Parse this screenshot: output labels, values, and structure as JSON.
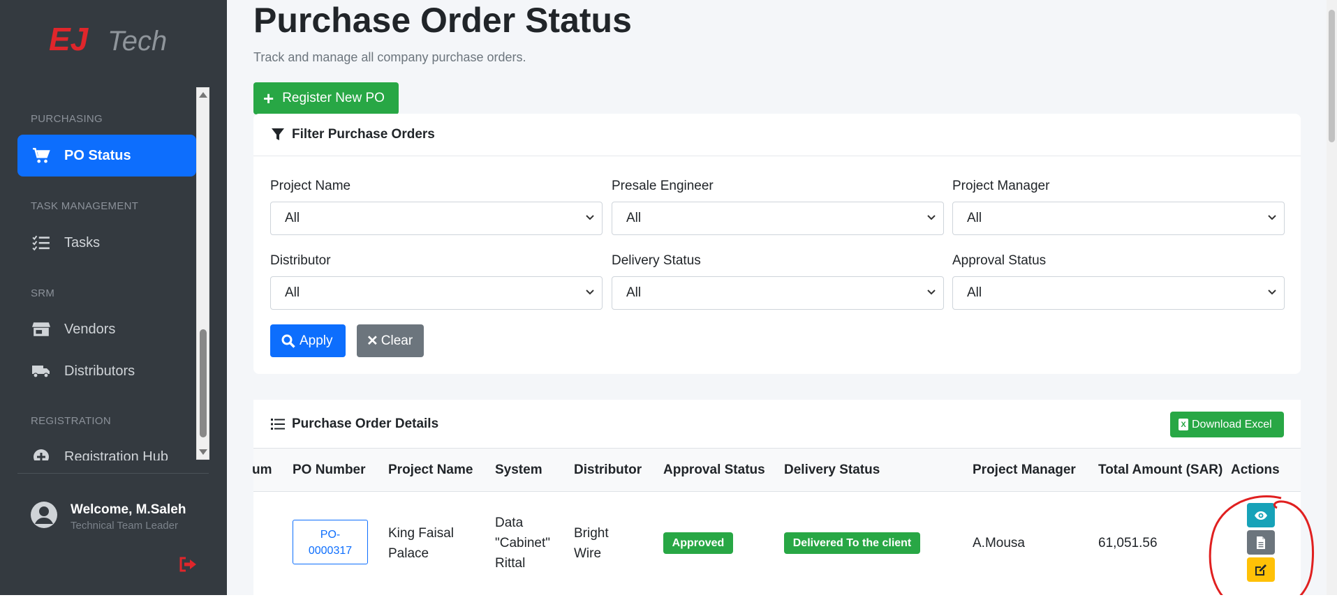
{
  "brand": {
    "logo_text_red": "EJ",
    "logo_text_gray": "Tech"
  },
  "sidebar": {
    "sections": [
      {
        "label": "PURCHASING"
      },
      {
        "label": "TASK MANAGEMENT"
      },
      {
        "label": "SRM"
      },
      {
        "label": "REGISTRATION"
      }
    ],
    "items": [
      {
        "label": "PO Status",
        "icon": "shopping-cart-icon",
        "active": true
      },
      {
        "label": "Tasks",
        "icon": "tasks-icon"
      },
      {
        "label": "Vendors",
        "icon": "store-icon"
      },
      {
        "label": "Distributors",
        "icon": "truck-icon"
      },
      {
        "label": "Registration Hub",
        "icon": "plus-circle-icon"
      }
    ],
    "user": {
      "name": "Welcome, M.Saleh",
      "role": "Technical Team Leader"
    }
  },
  "page": {
    "title": "Purchase Order Status",
    "subtitle": "Track and manage all company purchase orders.",
    "register_button": "Register New PO"
  },
  "filters": {
    "header": "Filter Purchase Orders",
    "fields": [
      {
        "label": "Project Name",
        "value": "All"
      },
      {
        "label": "Presale Engineer",
        "value": "All"
      },
      {
        "label": "Project Manager",
        "value": "All"
      },
      {
        "label": "Distributor",
        "value": "All"
      },
      {
        "label": "Delivery Status",
        "value": "All"
      },
      {
        "label": "Approval Status",
        "value": "All"
      }
    ],
    "apply_label": "Apply",
    "clear_label": "Clear"
  },
  "table": {
    "header": "Purchase Order Details",
    "download_label": "Download Excel",
    "columns": [
      "um",
      "PO Number",
      "Project Name",
      "System",
      "Distributor",
      "Approval Status",
      "Delivery Status",
      "Project Manager",
      "Total Amount (SAR)",
      "Actions"
    ],
    "rows": [
      {
        "po_number_line1": "PO-",
        "po_number_line2": "0000317",
        "project_name_line1": "King Faisal",
        "project_name_line2": "Palace",
        "system_line1": "Data",
        "system_line2": "\"Cabinet\"",
        "system_line3": "Rittal",
        "distributor_line1": "Bright",
        "distributor_line2": "Wire",
        "approval_status": "Approved",
        "delivery_status": "Delivered To the client",
        "project_manager": "A.Mousa",
        "total_amount": "61,051.56"
      }
    ]
  },
  "colors": {
    "sidebar_bg": "#343a40",
    "primary": "#0d6efd",
    "success": "#28a745",
    "secondary": "#6c757d",
    "info": "#17a2b8",
    "warning": "#ffc107",
    "annotation": "#e02020"
  }
}
